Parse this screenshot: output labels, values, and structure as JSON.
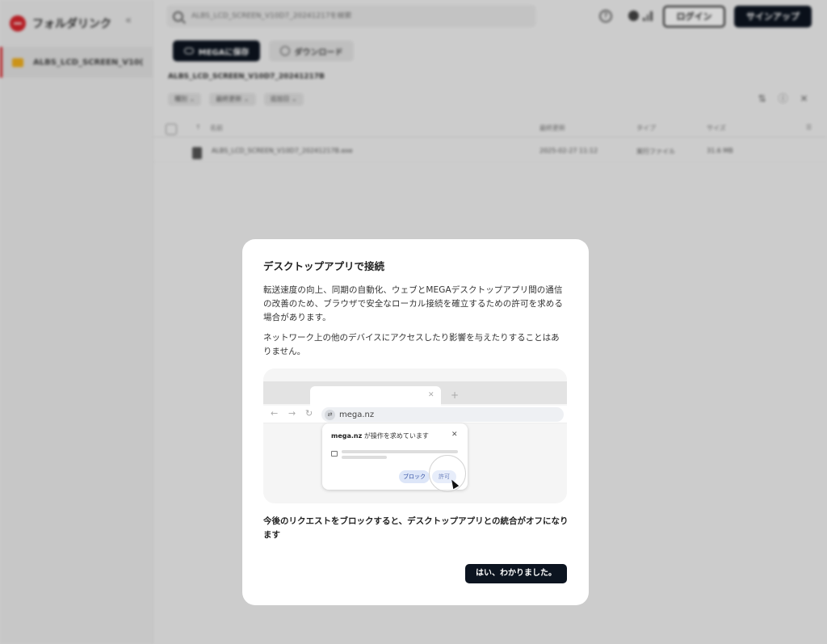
{
  "sidebar": {
    "brand": "フォルダリンク",
    "collapse_icon": "double-chevron-left-icon",
    "items": [
      {
        "label": "ALBS_LCD_SCREEN_V10("
      }
    ]
  },
  "header": {
    "search_placeholder": "ALBS_LCD_SCREEN_V10D7_20241217を検索",
    "login_label": "ログイン",
    "signup_label": "サインアップ"
  },
  "toolbar": {
    "mega_button": "MEGAに保存",
    "download_button": "ダウンロード"
  },
  "breadcrumb": "ALBS_LCD_SCREEN_V10D7_20241217B",
  "filters": [
    "種別",
    "最終更新",
    "追加日"
  ],
  "table": {
    "columns": [
      "名前",
      "最終更新",
      "タイプ",
      "サイズ"
    ],
    "rows": [
      {
        "name": "ALBS_LCD_SCREEN_V10D7_20241217B.exe",
        "modified": "2025-02-27 11:12",
        "type": "実行ファイル",
        "size": "31.6 MB"
      }
    ]
  },
  "modal": {
    "title": "デスクトップアプリで接続",
    "paragraph1": "転送速度の向上、同期の自動化、ウェブとMEGAデスクトップアプリ間の通信の改善のため、ブラウザで安全なローカル接続を確立するための許可を求める場合があります。",
    "paragraph2": "ネットワーク上の他のデバイスにアクセスしたり影響を与えたりすることはありません。",
    "illustration": {
      "url": "mega.nz",
      "popup_domain": "mega.nz",
      "popup_text": " が操作を求めています",
      "block_label": "ブロック",
      "allow_label": "許可"
    },
    "warning": "今後のリクエストをブロックすると、デスクトップアプリとの統合がオフになります",
    "ok_button": "はい、わかりました。"
  },
  "colors": {
    "brand_red": "#d9272e",
    "dark_button": "#0c1420",
    "folder_yellow": "#f2b01e"
  }
}
